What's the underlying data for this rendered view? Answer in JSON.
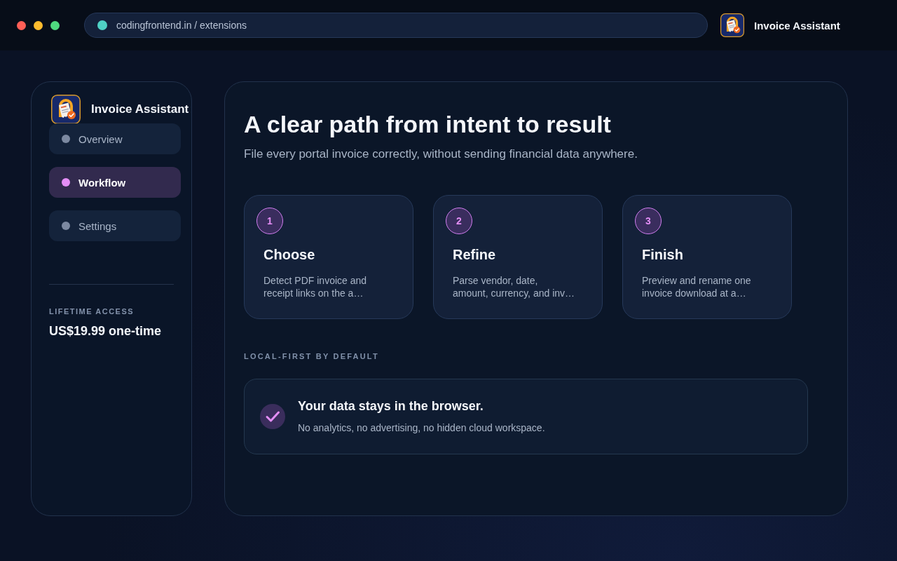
{
  "browser": {
    "address": "codingfrontend.in / extensions",
    "app_title": "Invoice Assistant"
  },
  "sidebar": {
    "title": "Invoice Assistant",
    "items": [
      {
        "label": "Overview",
        "selected": false
      },
      {
        "label": "Workflow",
        "selected": true
      },
      {
        "label": "Settings",
        "selected": false
      }
    ],
    "pricing": {
      "label": "LIFETIME ACCESS",
      "price": "US$19.99 one-time"
    }
  },
  "main": {
    "title": "A clear path from intent to result",
    "subtitle": "File every portal invoice correctly, without sending financial data anywhere.",
    "steps": [
      {
        "number": "1",
        "title": "Choose",
        "description": "Detect PDF invoice and receipt links on the a…"
      },
      {
        "number": "2",
        "title": "Refine",
        "description": "Parse vendor, date, amount, currency, and inv…"
      },
      {
        "number": "3",
        "title": "Finish",
        "description": "Preview and rename one invoice download at a…"
      }
    ],
    "section_label": "LOCAL-FIRST BY DEFAULT",
    "notice": {
      "title": "Your data stays in the browser.",
      "text": "No analytics, no advertising, no hidden cloud workspace."
    }
  }
}
